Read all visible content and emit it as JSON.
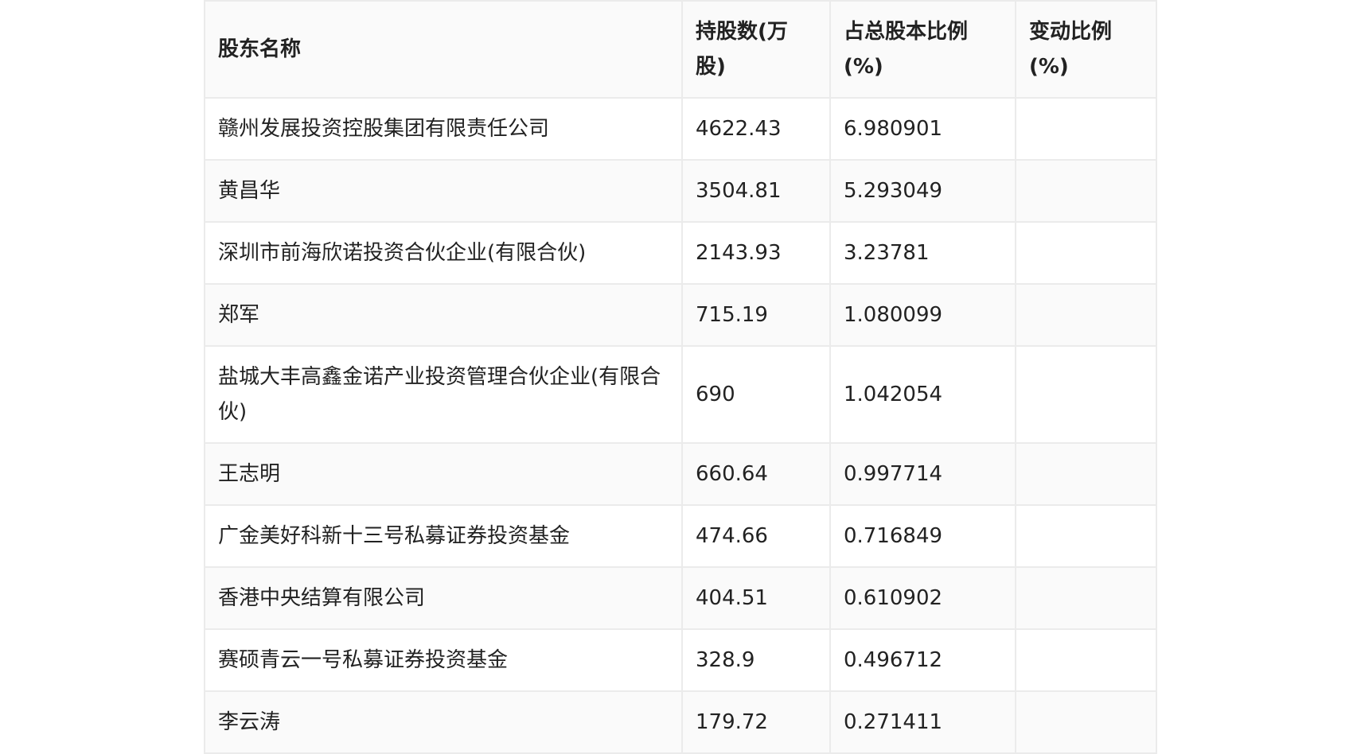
{
  "table": {
    "headers": {
      "name": "股东名称",
      "shares": "持股数(万股)",
      "pct": "占总股本比例(%)",
      "change": "变动比例(%)"
    },
    "rows": [
      {
        "name": "赣州发展投资控股集团有限责任公司",
        "shares": "4622.43",
        "pct": "6.980901",
        "change": ""
      },
      {
        "name": "黄昌华",
        "shares": "3504.81",
        "pct": "5.293049",
        "change": ""
      },
      {
        "name": "深圳市前海欣诺投资合伙企业(有限合伙)",
        "shares": "2143.93",
        "pct": "3.23781",
        "change": ""
      },
      {
        "name": "郑军",
        "shares": "715.19",
        "pct": "1.080099",
        "change": ""
      },
      {
        "name": "盐城大丰高鑫金诺产业投资管理合伙企业(有限合伙)",
        "shares": "690",
        "pct": "1.042054",
        "change": ""
      },
      {
        "name": "王志明",
        "shares": "660.64",
        "pct": "0.997714",
        "change": ""
      },
      {
        "name": "广金美好科新十三号私募证券投资基金",
        "shares": "474.66",
        "pct": "0.716849",
        "change": ""
      },
      {
        "name": "香港中央结算有限公司",
        "shares": "404.51",
        "pct": "0.610902",
        "change": ""
      },
      {
        "name": "赛硕青云一号私募证券投资基金",
        "shares": "328.9",
        "pct": "0.496712",
        "change": ""
      },
      {
        "name": "李云涛",
        "shares": "179.72",
        "pct": "0.271411",
        "change": ""
      }
    ]
  }
}
